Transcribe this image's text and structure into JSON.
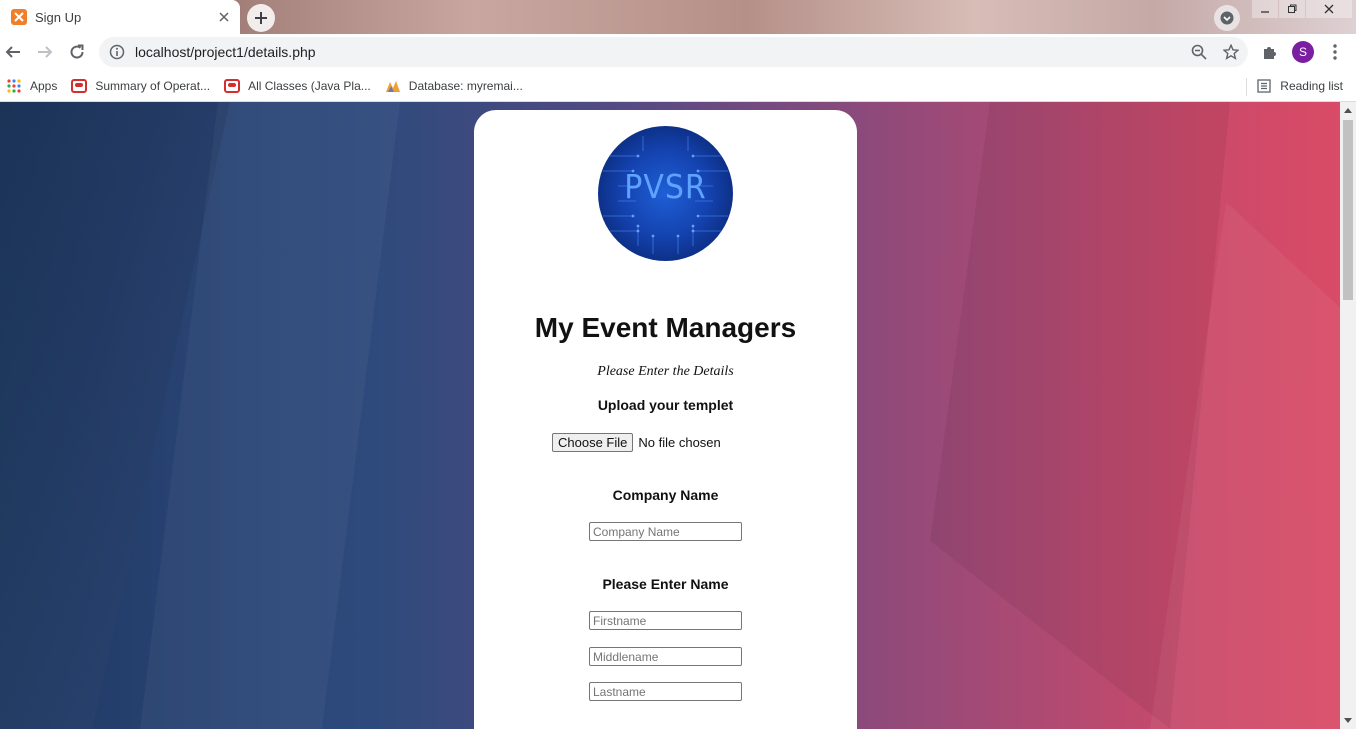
{
  "browser": {
    "tab_title": "Sign Up",
    "url": "localhost/project1/details.php",
    "profile_initial": "S",
    "bookmarks": [
      {
        "label": "Apps",
        "icon": "apps-grid-icon"
      },
      {
        "label": "Summary of Operat...",
        "icon": "oracle-icon"
      },
      {
        "label": "All Classes (Java Pla...",
        "icon": "oracle-icon"
      },
      {
        "label": "Database: myremai...",
        "icon": "phpmyadmin-icon"
      }
    ],
    "reading_list": "Reading list"
  },
  "page": {
    "logo_text": "PVSR",
    "title": "My Event Managers",
    "subtitle": "Please Enter the Details",
    "upload_label": "Upload your templet",
    "file_button": "Choose File",
    "file_status": "No file chosen",
    "company_label": "Company Name",
    "company_placeholder": "Company Name",
    "name_label": "Please Enter Name",
    "firstname_placeholder": "Firstname",
    "middlename_placeholder": "Middlename",
    "lastname_placeholder": "Lastname"
  },
  "colors": {
    "gradient_left": "#1f3a63",
    "gradient_right": "#d94b66",
    "logo_blue": "#1443b0",
    "profile_purple": "#7b1fa2"
  }
}
